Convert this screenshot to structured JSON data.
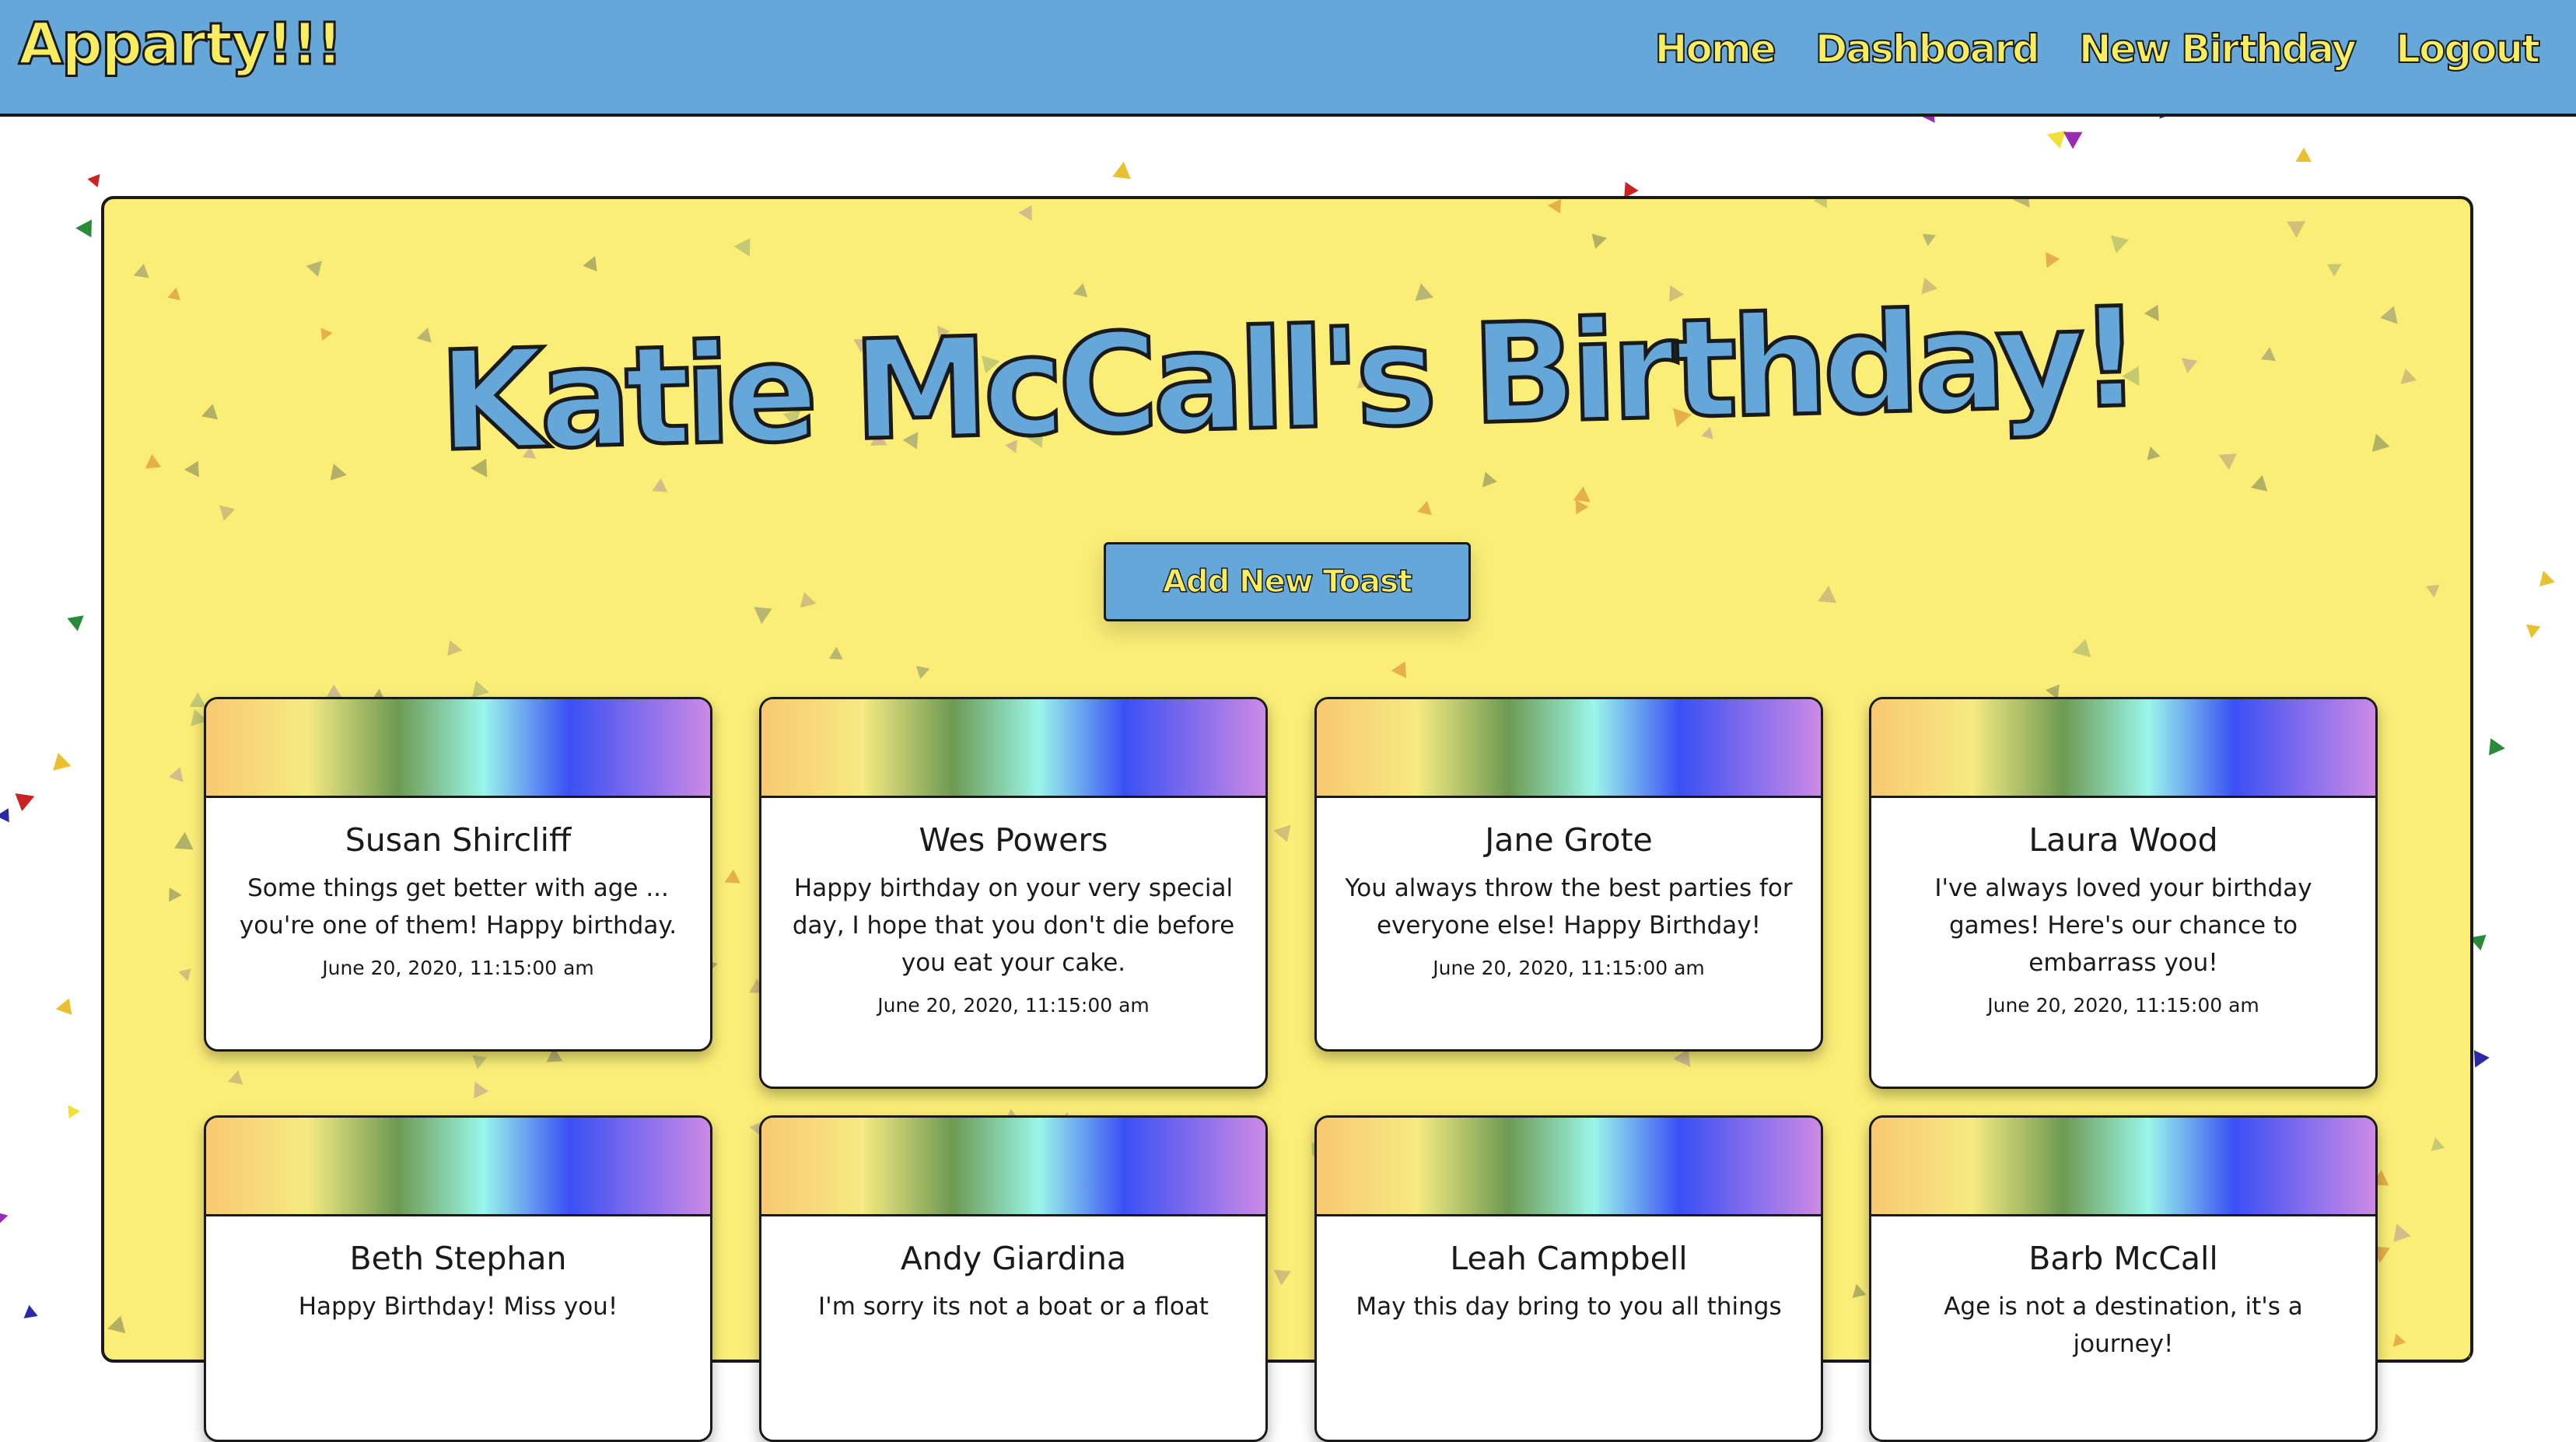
{
  "navbar": {
    "brand": "Apparty!!!",
    "links": [
      "Home",
      "Dashboard",
      "New Birthday",
      "Logout"
    ]
  },
  "page": {
    "title": "Katie McCall's Birthday!",
    "add_button": "Add New Toast"
  },
  "toasts": [
    {
      "name": "Susan Shircliff",
      "message": "Some things get better with age ... you're one of them! Happy birthday.",
      "date": "June 20, 2020, 11:15:00 am"
    },
    {
      "name": "Wes Powers",
      "message": "Happy birthday on your very special day, I hope that you don't die before you eat your cake.",
      "date": "June 20, 2020, 11:15:00 am"
    },
    {
      "name": "Jane Grote",
      "message": "You always throw the best parties for everyone else! Happy Birthday!",
      "date": "June 20, 2020, 11:15:00 am"
    },
    {
      "name": "Laura Wood",
      "message": "I've always loved your birthday games! Here's our chance to embarrass you!",
      "date": "June 20, 2020, 11:15:00 am"
    },
    {
      "name": "Beth Stephan",
      "message": "Happy Birthday! Miss you!",
      "date": ""
    },
    {
      "name": "Andy Giardina",
      "message": "I'm sorry its not a boat or a float",
      "date": ""
    },
    {
      "name": "Leah Campbell",
      "message": "May this day bring to you all things",
      "date": ""
    },
    {
      "name": "Barb McCall",
      "message": "Age is not a destination, it's a journey!",
      "date": ""
    }
  ],
  "colors": {
    "navbar": "#64a7d8",
    "panel": "#fbee77",
    "accent_yellow": "#f8ec60",
    "title_blue": "#64a7d8"
  }
}
